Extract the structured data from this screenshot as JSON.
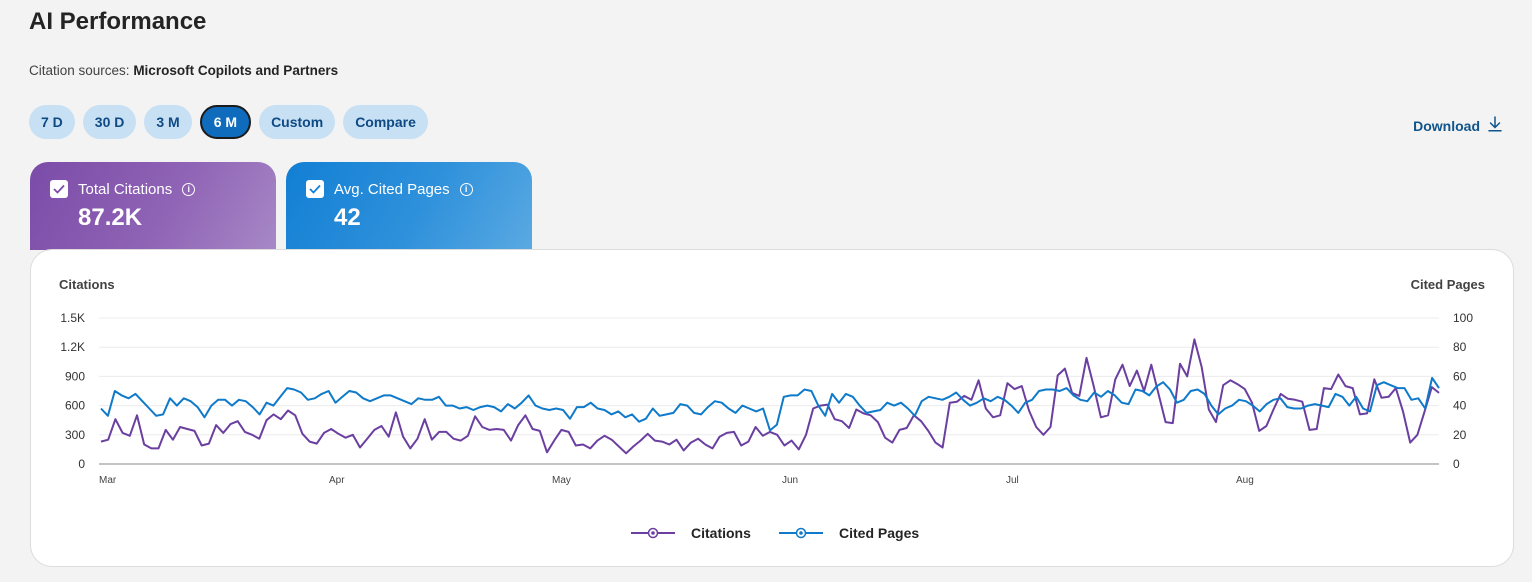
{
  "header": {
    "title": "AI Performance",
    "subtitle_prefix": "Citation sources:",
    "subtitle_value": "Microsoft Copilots and Partners"
  },
  "ranges": [
    {
      "label": "7 D",
      "active": false
    },
    {
      "label": "30 D",
      "active": false
    },
    {
      "label": "3 M",
      "active": false
    },
    {
      "label": "6 M",
      "active": true
    },
    {
      "label": "Custom",
      "active": false
    },
    {
      "label": "Compare",
      "active": false
    }
  ],
  "download": {
    "label": "Download",
    "icon": "download-icon"
  },
  "cards": [
    {
      "label": "Total Citations",
      "value": "87.2K",
      "checked": true,
      "color": "#7b4ca8"
    },
    {
      "label": "Avg. Cited Pages",
      "value": "42",
      "checked": true,
      "color": "#127fd4"
    }
  ],
  "chart_data": {
    "type": "line",
    "x_ticks": [
      "Mar",
      "Apr",
      "May",
      "Jun",
      "Jul",
      "Aug"
    ],
    "y_left": {
      "label": "Citations",
      "ticks": [
        "0",
        "300",
        "600",
        "900",
        "1.2K",
        "1.5K"
      ],
      "range": [
        0,
        1500
      ]
    },
    "y_right": {
      "label": "Cited Pages",
      "ticks": [
        "0",
        "20",
        "40",
        "60",
        "80",
        "100"
      ],
      "range": [
        0,
        100
      ]
    },
    "grid": true,
    "legend_position": "bottom",
    "series": [
      {
        "name": "Citations",
        "axis": "left",
        "color": "#6b3fa0",
        "values": [
          230,
          250,
          460,
          320,
          290,
          500,
          200,
          160,
          160,
          350,
          250,
          380,
          360,
          340,
          190,
          210,
          400,
          320,
          410,
          440,
          330,
          300,
          260,
          450,
          510,
          460,
          550,
          500,
          310,
          230,
          210,
          320,
          360,
          310,
          270,
          300,
          170,
          260,
          350,
          390,
          280,
          530,
          280,
          160,
          260,
          460,
          250,
          330,
          330,
          260,
          240,
          290,
          490,
          380,
          350,
          360,
          350,
          240,
          400,
          500,
          360,
          340,
          120,
          240,
          350,
          330,
          190,
          200,
          160,
          240,
          290,
          250,
          180,
          110,
          180,
          240,
          310,
          240,
          230,
          200,
          250,
          140,
          220,
          260,
          200,
          160,
          280,
          320,
          330,
          190,
          230,
          380,
          290,
          330,
          300,
          190,
          240,
          150,
          300,
          570,
          600,
          610,
          460,
          440,
          370,
          560,
          520,
          500,
          430,
          270,
          220,
          350,
          370,
          500,
          440,
          340,
          220,
          170,
          630,
          640,
          700,
          660,
          860,
          570,
          480,
          500,
          830,
          770,
          800,
          550,
          380,
          300,
          380,
          910,
          980,
          730,
          700,
          1090,
          800,
          480,
          500,
          870,
          1020,
          800,
          960,
          750,
          1020,
          720,
          430,
          420,
          1030,
          900,
          1280,
          1000,
          560,
          430,
          810,
          860,
          820,
          770,
          630,
          340,
          390,
          560,
          720,
          670,
          660,
          640,
          350,
          360,
          780,
          770,
          920,
          800,
          780,
          510,
          520,
          870,
          680,
          690,
          780,
          540,
          220,
          300,
          540,
          790,
          730
        ]
      },
      {
        "name": "Cited Pages",
        "axis": "right",
        "color": "#0e7ac9",
        "values": [
          38,
          33,
          50,
          47,
          45,
          48,
          43,
          38,
          33,
          34,
          45,
          40,
          45,
          43,
          39,
          32,
          40,
          44,
          44,
          40,
          44,
          43,
          39,
          34,
          42,
          40,
          46,
          52,
          51,
          49,
          44,
          45,
          48,
          50,
          42,
          46,
          50,
          49,
          45,
          43,
          45,
          47,
          47,
          45,
          43,
          41,
          45,
          44,
          44,
          46,
          40,
          40,
          38,
          39,
          37,
          39,
          40,
          39,
          36,
          41,
          38,
          42,
          47,
          40,
          38,
          37,
          38,
          37,
          31,
          39,
          39,
          42,
          38,
          37,
          34,
          36,
          32,
          34,
          29,
          31,
          38,
          33,
          34,
          35,
          41,
          40,
          35,
          34,
          39,
          43,
          42,
          38,
          35,
          40,
          38,
          36,
          38,
          23,
          27,
          46,
          47,
          47,
          51,
          50,
          40,
          33,
          48,
          42,
          48,
          46,
          40,
          35,
          36,
          37,
          42,
          40,
          42,
          38,
          33,
          43,
          46,
          45,
          44,
          46,
          49,
          44,
          40,
          42,
          45,
          43,
          46,
          44,
          40,
          35,
          42,
          44,
          50,
          51,
          51,
          50,
          52,
          47,
          44,
          43,
          49,
          46,
          50,
          47,
          42,
          41,
          51,
          50,
          47,
          53,
          56,
          51,
          42,
          44,
          50,
          51,
          48,
          40,
          34,
          38,
          40,
          44,
          43,
          40,
          36,
          41,
          44,
          45,
          39,
          38,
          38,
          40,
          41,
          40,
          39,
          48,
          46,
          40,
          46,
          38,
          36,
          54,
          56,
          54,
          52,
          52,
          44,
          45,
          38,
          59,
          52
        ]
      }
    ]
  }
}
